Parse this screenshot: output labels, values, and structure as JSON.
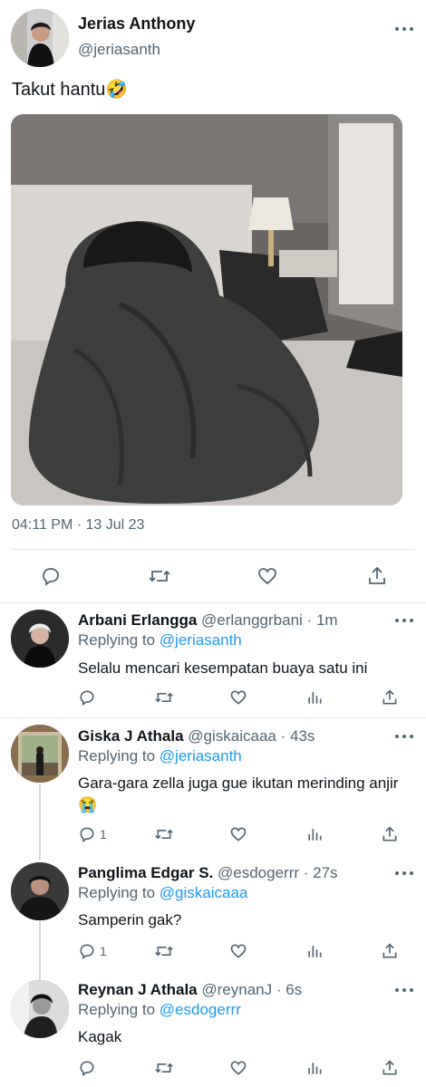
{
  "tweet": {
    "author_name": "Jerias Anthony",
    "author_handle": "@jeriasanth",
    "text": "Takut hantu",
    "emoji": "🤣",
    "timestamp": "04:11 PM · 13 Jul 23"
  },
  "replies": [
    {
      "name": "Arbani Erlangga",
      "handle": "@erlanggrbani",
      "time": "· 1m",
      "replying_label": "Replying to",
      "replying_to": "@jeriasanth",
      "text": "Selalu mencari kesempatan buaya satu ini",
      "reply_count": ""
    },
    {
      "name": "Giska J Athala",
      "handle": "@giskaicaaa",
      "time": "· 43s",
      "replying_label": "Replying to",
      "replying_to": "@jeriasanth",
      "text": "Gara-gara zella juga gue ikutan merinding anjir😭",
      "reply_count": "1"
    },
    {
      "name": "Panglima Edgar S.",
      "handle": "@esdogerrr",
      "time": "· 27s",
      "replying_label": "Replying to",
      "replying_to": "@giskaicaaa",
      "text": "Samperin gak?",
      "reply_count": "1"
    },
    {
      "name": "Reynan J Athala",
      "handle": "@reynanJ",
      "time": "· 6s",
      "replying_label": "Replying to",
      "replying_to": "@esdogerrr",
      "text": "Kagak",
      "reply_count": ""
    }
  ],
  "icons": {
    "reply": "speech-bubble-icon",
    "retweet": "retweet-icon",
    "like": "heart-icon",
    "share": "share-icon",
    "analytics": "analytics-icon",
    "more": "more-dots-icon"
  },
  "colors": {
    "link": "#1d9bf0",
    "secondary": "#536471",
    "divider": "#e1e6ea"
  }
}
